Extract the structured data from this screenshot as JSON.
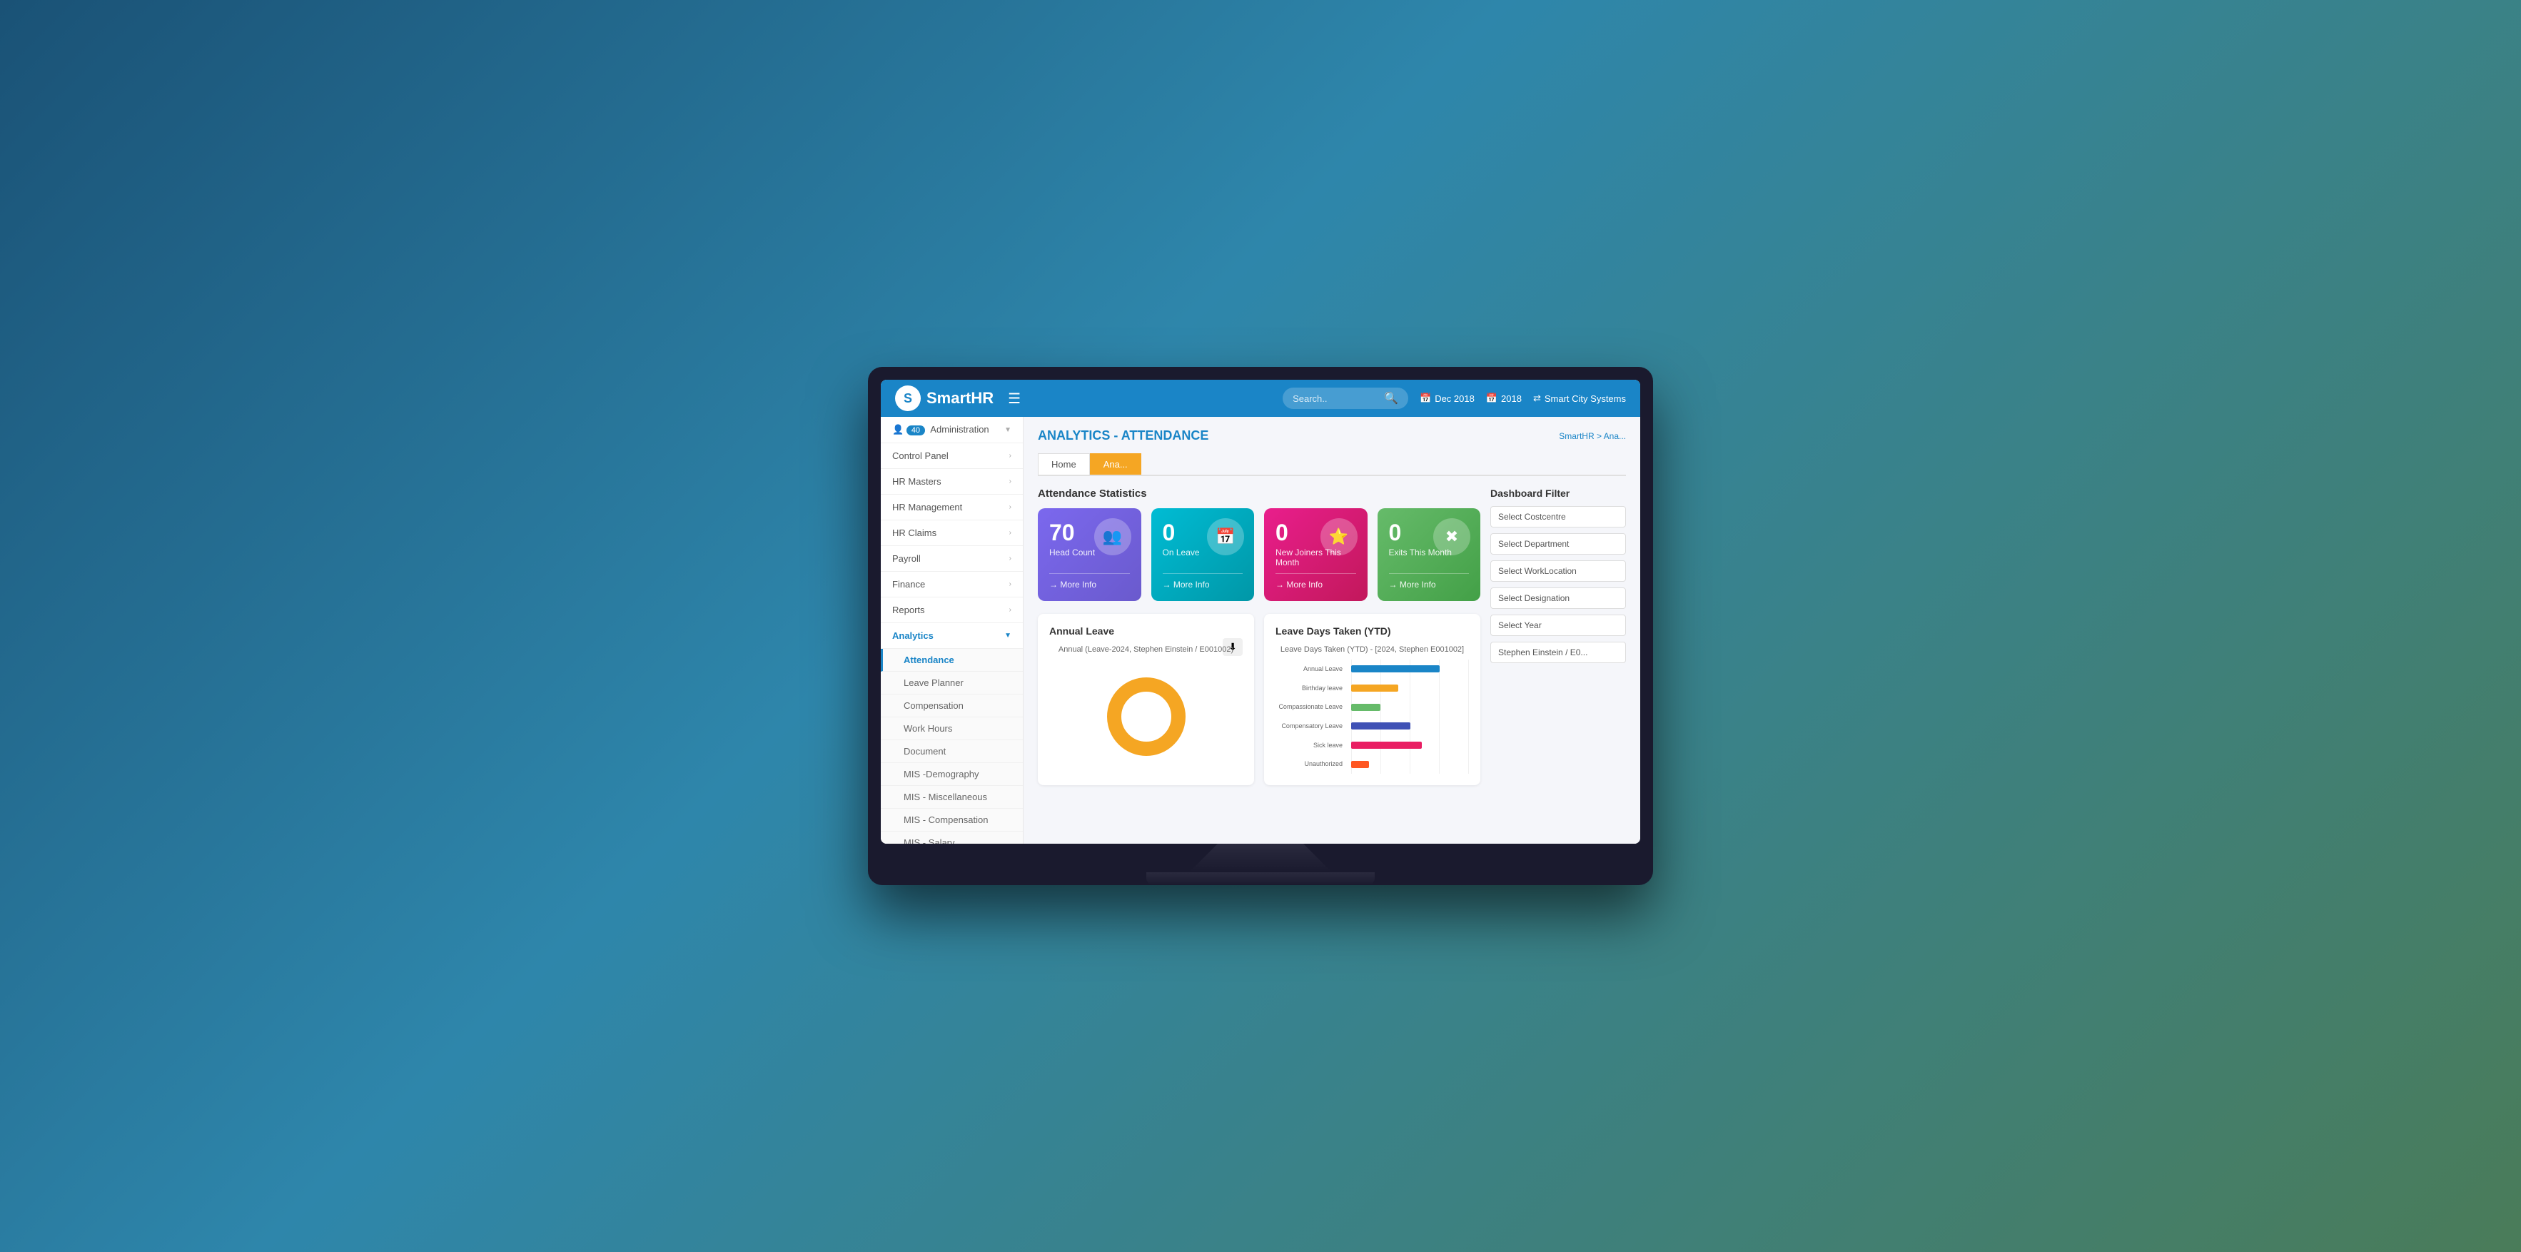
{
  "app": {
    "name": "SmartHR",
    "logo_text": "SmartHR"
  },
  "topbar": {
    "search_placeholder": "Search..",
    "date1": "Dec 2018",
    "date2": "2018",
    "org": "Smart City Systems"
  },
  "page": {
    "title_prefix": "ANALYTICS - ",
    "title_accent": "ATTENDANCE",
    "breadcrumb": "SmartHR > Ana...",
    "home_tab": "Home",
    "active_tab": "Ana..."
  },
  "sidebar": {
    "administration_label": "Administration",
    "administration_badge": "40",
    "items": [
      {
        "label": "Control Panel",
        "has_arrow": true
      },
      {
        "label": "HR Masters",
        "has_arrow": true
      },
      {
        "label": "HR Management",
        "has_arrow": true
      },
      {
        "label": "HR Claims",
        "has_arrow": true
      },
      {
        "label": "Payroll",
        "has_arrow": true
      },
      {
        "label": "Finance",
        "has_arrow": true
      },
      {
        "label": "Reports",
        "has_arrow": true
      },
      {
        "label": "Analytics",
        "has_arrow": true,
        "active": true
      }
    ],
    "analytics_sub": [
      {
        "label": "Attendance",
        "active": true
      },
      {
        "label": "Leave Planner"
      },
      {
        "label": "Compensation"
      },
      {
        "label": "Work Hours"
      },
      {
        "label": "Document"
      },
      {
        "label": "MIS -Demography"
      },
      {
        "label": "MIS - Miscellaneous"
      },
      {
        "label": "MIS - Compensation"
      },
      {
        "label": "MIS - Salary"
      }
    ]
  },
  "stats": {
    "section_title": "Attendance Statistics",
    "cards": [
      {
        "number": "70",
        "label": "Head Count",
        "more": "→ More Info",
        "color": "purple",
        "icon": "👥"
      },
      {
        "number": "0",
        "label": "On Leave",
        "more": "→ More Info",
        "color": "cyan",
        "icon": "📅"
      },
      {
        "number": "0",
        "label": "New Joiners This Month",
        "more": "→ More Info",
        "color": "pink",
        "icon": "⭐"
      },
      {
        "number": "0",
        "label": "Exits This Month",
        "more": "→ More Info",
        "color": "green",
        "icon": "✖"
      }
    ]
  },
  "filter": {
    "title": "Dashboard Filter",
    "options": [
      {
        "label": "Select Costcentre",
        "value": ""
      },
      {
        "label": "Select Department",
        "value": ""
      },
      {
        "label": "Select WorkLocation",
        "value": ""
      },
      {
        "label": "Select Designation",
        "value": ""
      },
      {
        "label": "Select Year",
        "value": ""
      },
      {
        "label": "Stephen Einstein / E0...",
        "value": ""
      }
    ]
  },
  "annual_leave_chart": {
    "title": "Annual Leave",
    "chart_label": "Annual (Leave-2024, Stephen Einstein / E001002)",
    "download_icon": "⬇"
  },
  "leave_ytd_chart": {
    "title": "Leave Days Taken (YTD)",
    "chart_label": "Leave Days Taken (YTD) - [2024, Stephen E001002]",
    "categories": [
      {
        "label": "Annual Leave",
        "color": "#1a85c7",
        "value": 15
      },
      {
        "label": "Birthday leave",
        "color": "#f5a623",
        "value": 8
      },
      {
        "label": "Compassionate Leave",
        "color": "#66bb6a",
        "value": 5
      },
      {
        "label": "Compensatory Leave",
        "color": "#3f51b5",
        "value": 10
      },
      {
        "label": "Sick leave",
        "color": "#e91e63",
        "value": 12
      },
      {
        "label": "Unauthorized",
        "color": "#ff5722",
        "value": 3
      }
    ]
  }
}
